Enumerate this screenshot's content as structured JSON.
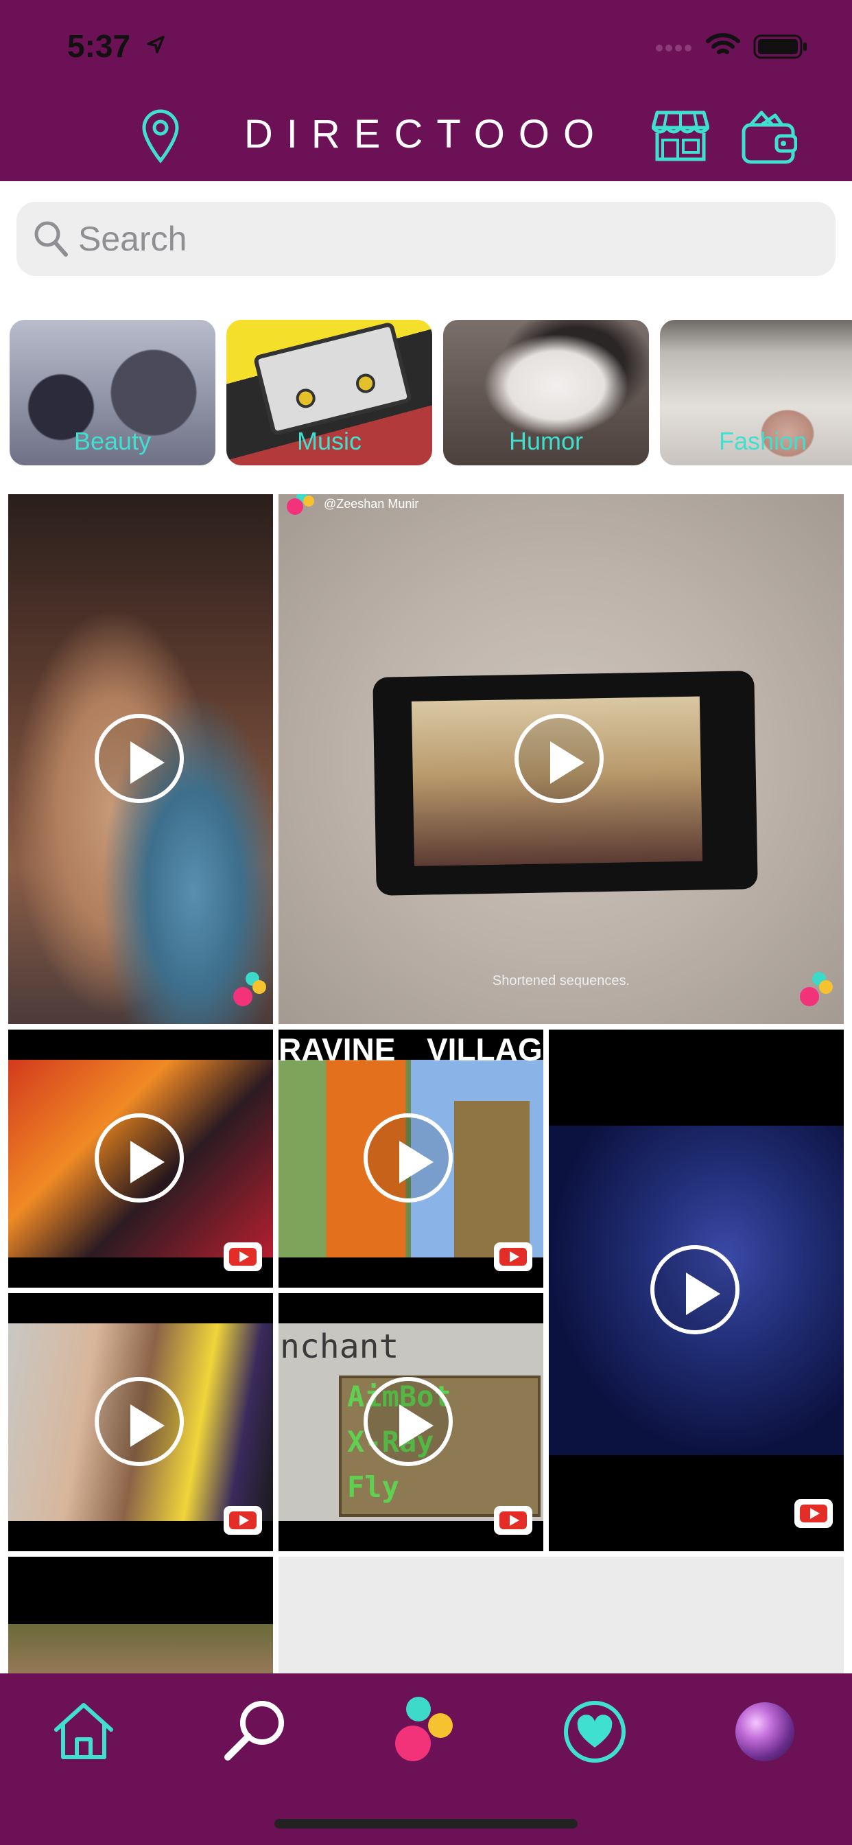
{
  "status_bar": {
    "time": "5:37"
  },
  "header": {
    "brand": "DIRECTOOO",
    "icons": [
      "location-pin-icon",
      "store-icon",
      "wallet-icon"
    ]
  },
  "search": {
    "placeholder": "Search",
    "value": ""
  },
  "categories": [
    {
      "label": "Beauty"
    },
    {
      "label": "Music"
    },
    {
      "label": "Humor"
    },
    {
      "label": "Fashion"
    }
  ],
  "feed": {
    "tile2": {
      "handle": "@Zeeshan Munir",
      "caption": "Shortened sequences."
    },
    "tile4": {
      "label_left": "RAVINE",
      "label_right": "VILLAG"
    },
    "tile7": {
      "title": "nchant",
      "row1": "AimBot",
      "row2": "X-Ray",
      "row3": "Fly"
    }
  },
  "tabbar": {
    "items": [
      "home-icon",
      "search-icon",
      "directooo-logo-icon",
      "favorites-heart-icon",
      "profile-avatar"
    ]
  },
  "colors": {
    "brand_purple": "#6c1155",
    "accent_teal": "#3fe0d0",
    "logo_pink": "#f2337a",
    "logo_yellow": "#f7c230",
    "logo_teal": "#3dd9c9"
  }
}
